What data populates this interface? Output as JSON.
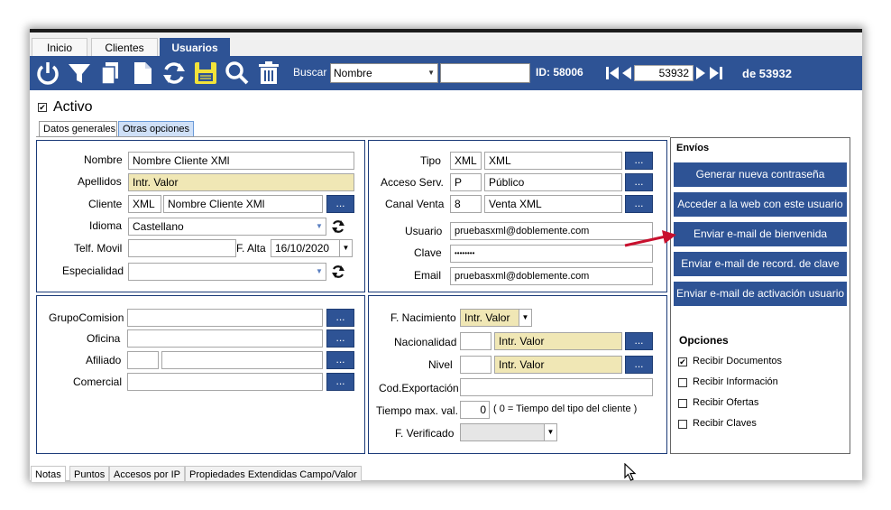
{
  "tabs": [
    "Inicio",
    "Clientes",
    "Usuarios"
  ],
  "toolbar": {
    "buscar_label": "Buscar",
    "buscar_field": "Nombre",
    "search_value": "",
    "id_text": "ID: 58006",
    "record_value": "53932",
    "total_text": "de 53932",
    "icons": [
      "power-icon",
      "filter-icon",
      "copy-icon",
      "new-document-icon",
      "refresh-icon",
      "save-icon",
      "search-icon",
      "delete-icon"
    ]
  },
  "activo_label": "Activo",
  "subtabs": [
    "Datos generales",
    "Otras opciones"
  ],
  "left_top": {
    "nombre_label": "Nombre",
    "nombre_value": "Nombre Cliente XMl",
    "apellidos_label": "Apellidos",
    "apellidos_value": "Intr. Valor",
    "cliente_label": "Cliente",
    "cliente_code": "XML",
    "cliente_value": "Nombre Cliente XMl",
    "idioma_label": "Idioma",
    "idioma_value": "Castellano",
    "telf_label": "Telf. Movil",
    "telf_value": "",
    "falta_label": "F. Alta",
    "falta_value": "16/10/2020",
    "especialidad_label": "Especialidad",
    "especialidad_value": ""
  },
  "right_top": {
    "tipo_label": "Tipo",
    "tipo_code": "XML",
    "tipo_value": "XML",
    "acceso_label": "Acceso Serv.",
    "acceso_code": "P",
    "acceso_value": "Público",
    "canal_label": "Canal Venta",
    "canal_code": "8",
    "canal_value": "Venta XML",
    "usuario_label": "Usuario",
    "usuario_value": "pruebasxml@doblemente.com",
    "clave_label": "Clave",
    "clave_value": "••••••••",
    "email_label": "Email",
    "email_value": "pruebasxml@doblemente.com"
  },
  "left_bottom": {
    "grupo_label": "GrupoComision",
    "oficina_label": "Oficina",
    "afiliado_label": "Afiliado",
    "comercial_label": "Comercial"
  },
  "right_bottom": {
    "fnac_label": "F. Nacimiento",
    "fnac_value": "Intr. Valor",
    "nacionalidad_label": "Nacionalidad",
    "nacionalidad_value": "Intr. Valor",
    "nivel_label": "Nivel",
    "nivel_value": "Intr. Valor",
    "codexp_label": "Cod.Exportación",
    "tiempo_label": "Tiempo max. val.",
    "tiempo_value": "0",
    "tiempo_note": "( 0 = Tiempo del tipo del cliente )",
    "fverif_label": "F. Verificado"
  },
  "envios": {
    "title": "Envíos",
    "buttons": [
      "Generar nueva contraseña",
      "Acceder a la web con este usuario",
      "Enviar e-mail de bienvenida",
      "Enviar e-mail de record. de clave",
      "Enviar e-mail de activación usuario"
    ]
  },
  "opciones": {
    "title": "Opciones",
    "items": [
      {
        "label": "Recibir Documentos",
        "checked": true
      },
      {
        "label": "Recibir Información",
        "checked": false
      },
      {
        "label": "Recibir Ofertas",
        "checked": false
      },
      {
        "label": "Recibir Claves",
        "checked": false
      }
    ]
  },
  "bottom_tabs": [
    "Notas",
    "Puntos",
    "Accesos por IP",
    "Propiedades Extendidas Campo/Valor"
  ],
  "dots_label": "...",
  "colors": {
    "accent": "#2e5395",
    "highlight": "#f0e7b5",
    "arrow": "#c8102e"
  }
}
